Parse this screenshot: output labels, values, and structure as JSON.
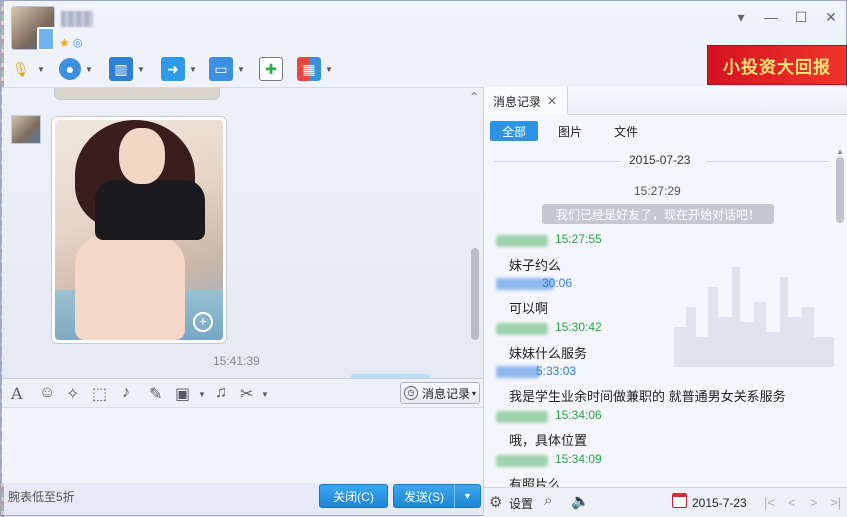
{
  "window": {
    "minimize_glyph": "▾",
    "restore_glyph": "—",
    "maximize_glyph": "☐",
    "close_glyph": "✕"
  },
  "toolbar": {
    "items": [
      "microphone-icon",
      "video-icon",
      "screen-share-icon",
      "file-transfer-icon",
      "remote-desktop-icon",
      "add-note-icon",
      "apps-grid-icon"
    ]
  },
  "ad": {
    "text": "小投资大回报"
  },
  "chat": {
    "message_time": "15:41:39"
  },
  "input_toolbar": {
    "font_glyph": "A",
    "emoji_glyph": "☺",
    "history_label": "消息记录",
    "history_caret": "▾"
  },
  "bottom": {
    "promo": "腕表低至5折",
    "close_label": "关闭(C)",
    "send_label": "发送(S)",
    "send_caret": "▼"
  },
  "history_panel": {
    "tab_label": "消息记录",
    "tab_close": "✕",
    "filters": [
      "全部",
      "图片",
      "文件"
    ],
    "date": "2015-07-23",
    "system_time": "15:27:29",
    "system_note": "我们已经是好友了，现在开始对话吧！",
    "messages": [
      {
        "time": "15:27:55",
        "text": "妹子约么",
        "color": "#27a34a"
      },
      {
        "time": "30:06",
        "text": "可以啊",
        "color": "#2a7fd4"
      },
      {
        "time": "15:30:42",
        "text": "妹妹什么服务",
        "color": "#27a34a"
      },
      {
        "time": "5:33:03",
        "text": "我是学生业余时间做兼职的 就普通男女关系服务",
        "color": "#2a7fd4"
      },
      {
        "time": "15:34:06",
        "text": "哦，具体位置",
        "color": "#27a34a"
      },
      {
        "time": "15:34:09",
        "text": "有照片么",
        "color": "#27a34a"
      }
    ],
    "footer": {
      "settings_label": "设置",
      "date_label": "2015-7-23"
    }
  }
}
